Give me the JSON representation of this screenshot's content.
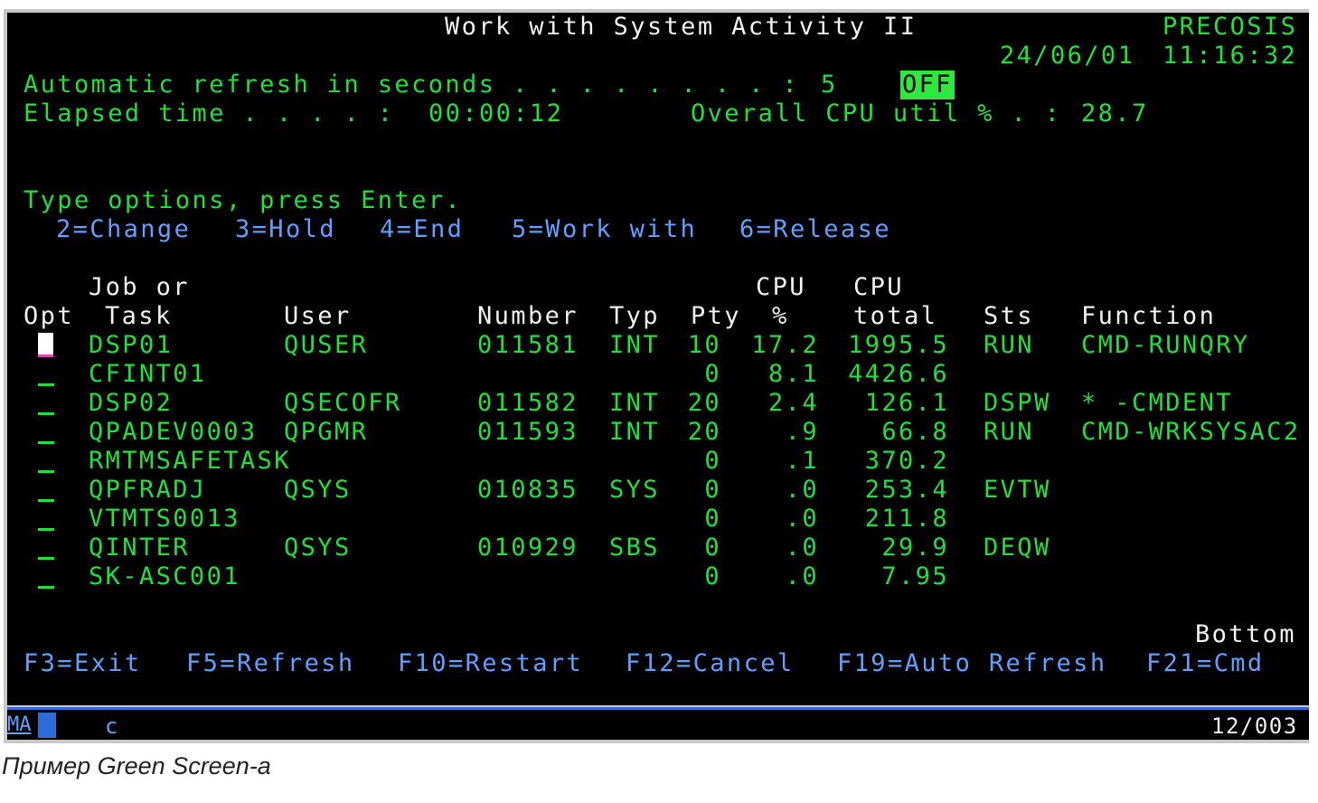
{
  "header": {
    "title": "Work with System Activity II",
    "system": "PRECOSIS",
    "date": "24/06/01",
    "time": "11:16:32"
  },
  "refresh": {
    "label": "Automatic refresh in seconds . . . . . . . . :",
    "value": "5",
    "toggle": "OFF"
  },
  "elapsed": {
    "label": "Elapsed time . . . . :",
    "value": "00:00:12"
  },
  "cpu_overall": {
    "label": "Overall CPU util % . :",
    "value": "28.7"
  },
  "instructions": {
    "heading": "Type options, press Enter.",
    "options": [
      "2=Change",
      "3=Hold",
      "4=End",
      "5=Work with",
      "6=Release"
    ]
  },
  "table": {
    "headers": {
      "job_top": "Job or",
      "opt": "Opt",
      "task": "Task",
      "user": "User",
      "number": "Number",
      "typ": "Typ",
      "pty": "Pty",
      "cpu_pct_top": "CPU",
      "cpu_pct": "%",
      "cpu_total_top": "CPU",
      "cpu_total": "total",
      "sts": "Sts",
      "function": "Function"
    },
    "rows": [
      {
        "task": "DSP01",
        "user": "QUSER",
        "number": "011581",
        "typ": "INT",
        "pty": "10",
        "cpu_pct": "17.2",
        "cpu_total": "1995.5",
        "sts": "RUN",
        "function": "CMD-RUNQRY"
      },
      {
        "task": "CFINT01",
        "user": "",
        "number": "",
        "typ": "",
        "pty": "0",
        "cpu_pct": "8.1",
        "cpu_total": "4426.6",
        "sts": "",
        "function": ""
      },
      {
        "task": "DSP02",
        "user": "QSECOFR",
        "number": "011582",
        "typ": "INT",
        "pty": "20",
        "cpu_pct": "2.4",
        "cpu_total": "126.1",
        "sts": "DSPW",
        "function": "* -CMDENT"
      },
      {
        "task": "QPADEV0003",
        "user": "QPGMR",
        "number": "011593",
        "typ": "INT",
        "pty": "20",
        "cpu_pct": ".9",
        "cpu_total": "66.8",
        "sts": "RUN",
        "function": "CMD-WRKSYSAC2"
      },
      {
        "task": "RMTMSAFETASK",
        "user": "",
        "number": "",
        "typ": "",
        "pty": "0",
        "cpu_pct": ".1",
        "cpu_total": "370.2",
        "sts": "",
        "function": ""
      },
      {
        "task": "QPFRADJ",
        "user": "QSYS",
        "number": "010835",
        "typ": "SYS",
        "pty": "0",
        "cpu_pct": ".0",
        "cpu_total": "253.4",
        "sts": "EVTW",
        "function": ""
      },
      {
        "task": "VTMTS0013",
        "user": "",
        "number": "",
        "typ": "",
        "pty": "0",
        "cpu_pct": ".0",
        "cpu_total": "211.8",
        "sts": "",
        "function": ""
      },
      {
        "task": "QINTER",
        "user": "QSYS",
        "number": "010929",
        "typ": "SBS",
        "pty": "0",
        "cpu_pct": ".0",
        "cpu_total": "29.9",
        "sts": "DEQW",
        "function": ""
      },
      {
        "task": "SK-ASC001",
        "user": "",
        "number": "",
        "typ": "",
        "pty": "0",
        "cpu_pct": ".0",
        "cpu_total": "7.95",
        "sts": "",
        "function": ""
      }
    ],
    "footer_marker": "Bottom"
  },
  "function_keys": [
    "F3=Exit",
    "F5=Refresh",
    "F10=Restart",
    "F12=Cancel",
    "F19=Auto Refresh",
    "F21=Cmd"
  ],
  "status_bar": {
    "mode": "MA",
    "indicator": "c",
    "position": "12/003"
  },
  "caption": "Пример Green Screen-а",
  "colors": {
    "background": "#000000",
    "text_green": "#22e03a",
    "text_white": "#f0f0f0",
    "text_blue": "#5ea0ff",
    "highlight": "#2ee83e"
  }
}
